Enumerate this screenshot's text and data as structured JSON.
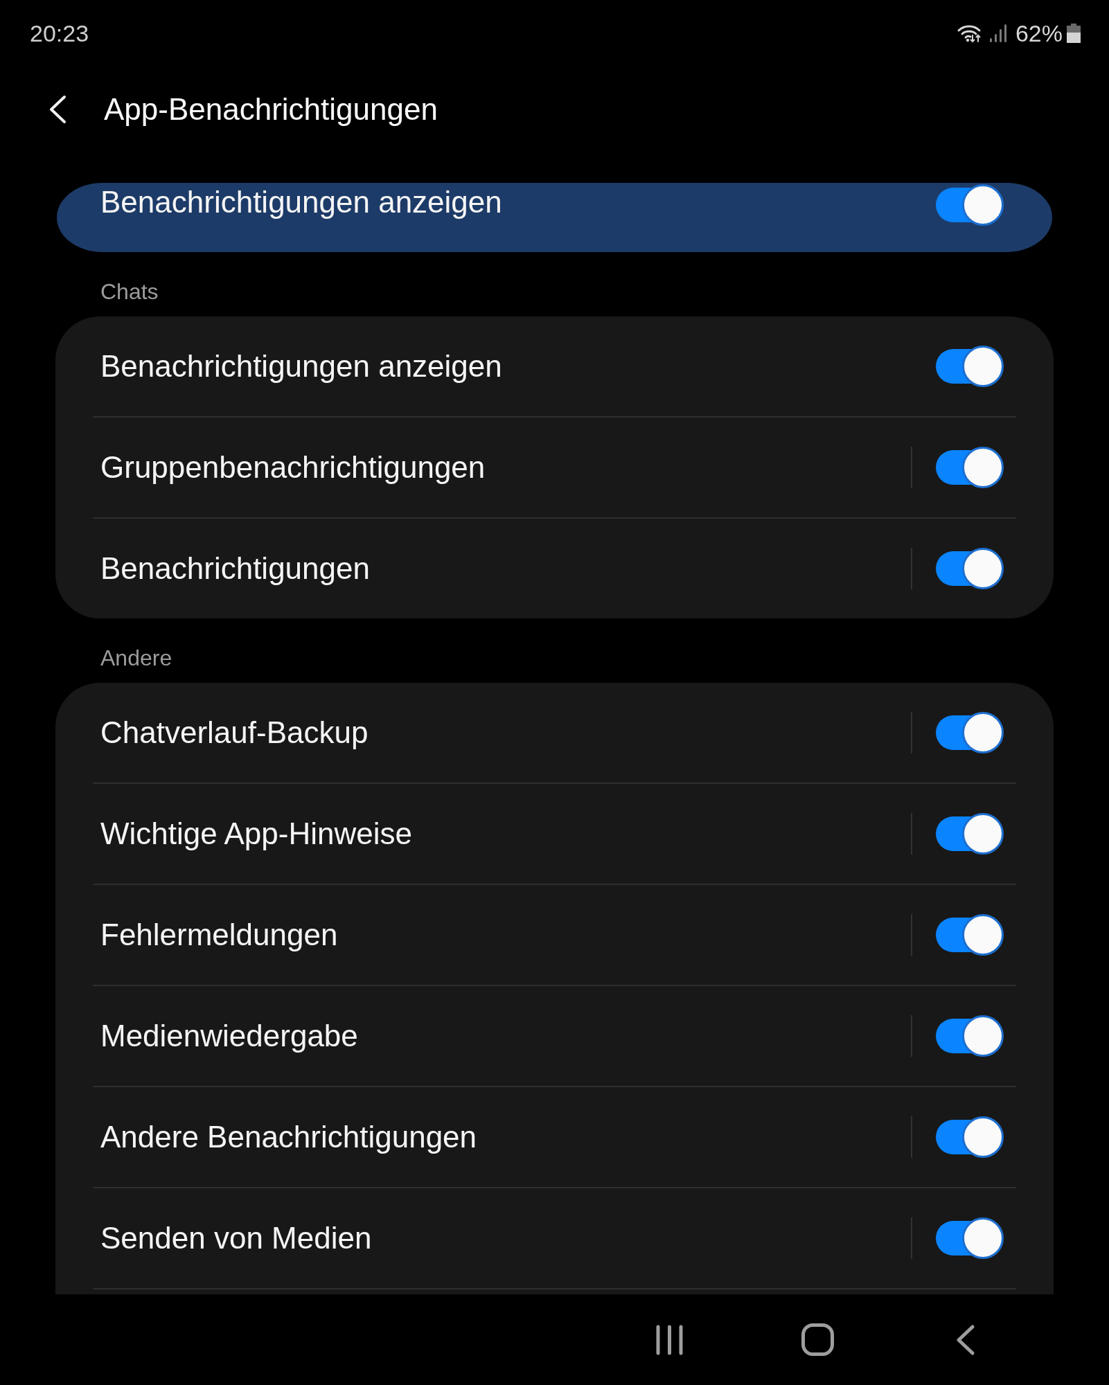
{
  "status_bar": {
    "time": "20:23",
    "battery": "62%"
  },
  "header": {
    "title": "App-Benachrichtigungen"
  },
  "master_switch": {
    "label": "Benachrichtigungen anzeigen",
    "on": true
  },
  "sections": [
    {
      "title": "Chats",
      "continues_below": false,
      "items": [
        {
          "label": "Benachrichtigungen anzeigen",
          "kind": "plain",
          "on": true
        },
        {
          "label": "Gruppenbenachrichtigungen",
          "kind": "split",
          "on": true
        },
        {
          "label": "Benachrichtigungen",
          "kind": "split",
          "on": true
        }
      ]
    },
    {
      "title": "Andere",
      "continues_below": true,
      "items": [
        {
          "label": "Chatverlauf-Backup",
          "kind": "split",
          "on": true
        },
        {
          "label": "Wichtige App-Hinweise",
          "kind": "split",
          "on": true
        },
        {
          "label": "Fehlermeldungen",
          "kind": "split",
          "on": true
        },
        {
          "label": "Medienwiedergabe",
          "kind": "split",
          "on": true
        },
        {
          "label": "Andere Benachrichtigungen",
          "kind": "split",
          "on": true
        },
        {
          "label": "Senden von Medien",
          "kind": "split",
          "on": true
        }
      ]
    }
  ]
}
